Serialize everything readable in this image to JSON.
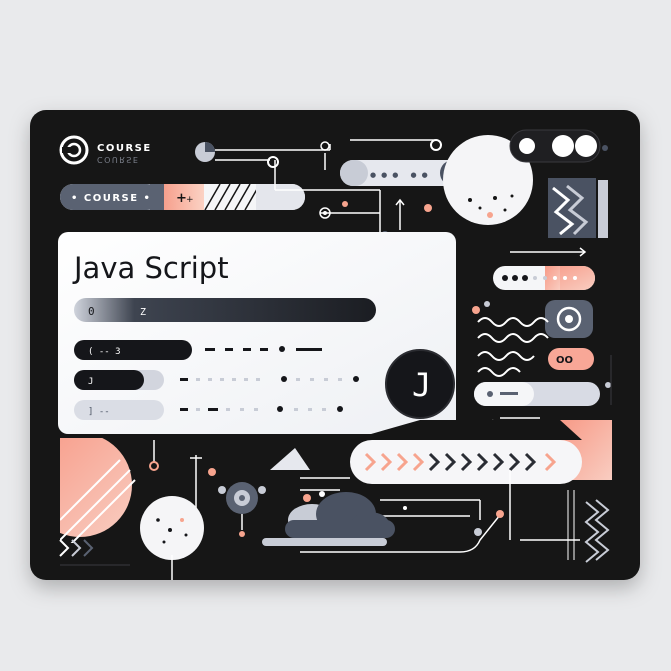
{
  "brand": {
    "logo_text": "COURSE",
    "logo_mirror_text": "COURSE"
  },
  "course_pill": {
    "label": "• COURSE •",
    "plus": "+"
  },
  "card": {
    "title": "Java Script",
    "bar_glyph_left": "0",
    "bar_glyph_mid": "Z",
    "row1_glyph": "( -- 3",
    "row2_glyph": "J",
    "row3_glyph": "] --",
    "j_badge": "J"
  },
  "toggle_pill": {
    "label": "●●● ●●"
  },
  "arrow_pill": {
    "glyphs": "> > > > > > > > > > >"
  },
  "small_pills": {
    "dots_label": "● ● ●",
    "double_o": "OO"
  },
  "colors": {
    "panel": "#151515",
    "card": "#f7f7f9",
    "accent_peach": "#f7a48e",
    "accent_pink": "#f8b3a3",
    "slate": "#4a5262",
    "light_slate": "#c8ccd6",
    "outline": "#ffffff"
  },
  "icons": [
    "course-logo-icon",
    "target-icon",
    "chevron-right-icon",
    "plus-icon",
    "cloud-icon",
    "gear-icon",
    "j-badge-icon",
    "wave-icon",
    "zigzag-icon"
  ]
}
